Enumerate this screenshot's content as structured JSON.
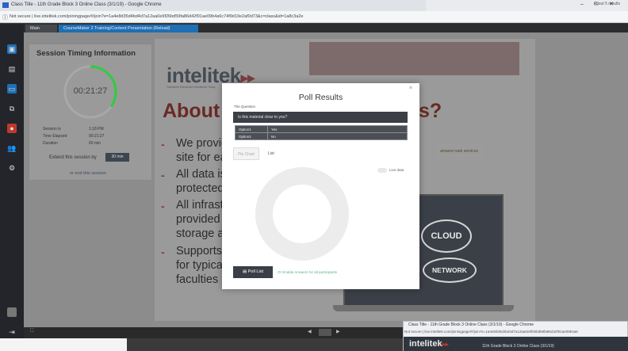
{
  "browser": {
    "title": "Class Title - 11th Grade Block 3 Online Class (3/1/19) - Google Chrome",
    "address": "Not secure | live.intelitek.com/joiningpage/#/join?e=1a4e8d35d4bd4d7a12aa0e9f26bd59fa86d42f01ae09b4a6c74f9d19e2af0d73&c=class&id=1a8c3a2e",
    "corner_text": "About 5 results",
    "window_controls": [
      "–",
      "□",
      "✕"
    ]
  },
  "tabs": [
    {
      "label": "Main"
    },
    {
      "label": "CourseMaker 2 Training/Content Presentation (Reload)"
    }
  ],
  "slide": {
    "logo": "intelitek",
    "logo_arrow": "▸▸",
    "tagline": "Transform Tomorrow's Workforce Today",
    "heading_left": "About",
    "heading_right": "s?",
    "bullets": [
      [
        "We provid",
        "site  for ea"
      ],
      [
        "All data is",
        "protected"
      ],
      [
        "All infrast",
        "provided b",
        "storage ar"
      ],
      [
        "Supports c",
        "for typical",
        "faculties"
      ]
    ],
    "partner_logo": "amazon web services",
    "cloud_text": "CLOUD",
    "network_text": "NETWORK"
  },
  "session": {
    "title": "Session Timing Information",
    "timer": "00:21:27",
    "rows": [
      {
        "label": "Session is",
        "value": "1:18 PM"
      },
      {
        "label": "Time Elapsed",
        "value": "00:21:27"
      },
      {
        "label": "Duration",
        "value": "60 min"
      }
    ],
    "extend_label": "Extend this session by",
    "extend_button": "30 min",
    "end_link": "or end this session"
  },
  "poll": {
    "title": "Poll Results",
    "close": "×",
    "question_label": "The Question",
    "question": "Is this material clear to you?",
    "options": [
      {
        "option": "Option1",
        "answer": "Yes"
      },
      {
        "option": "Option2",
        "answer": "No"
      }
    ],
    "chart_tab": "Pie Chart",
    "list_tab": "List",
    "toggle_label": "Live data",
    "poll_live_button": "Poll List",
    "enable_link": "Or Enable Answers for all participants"
  },
  "second_window": {
    "title": "Class Title - 11th Grade Block 3 Online Class (3/1/19) - Google Chrome",
    "address": "Not secure | live.intelitek.com/joiningpage/#/join?e=1a4e8d35d4bd4d7a12aa0e9f26bd59fa86d42f01ae09b4a6",
    "logo": "intelitek",
    "logo_arrow": "▸▸",
    "class_name": "11th Grade Block 3 Online Class (3/1/19)"
  },
  "colors": {
    "accent": "#1f6fb5",
    "timer": "#2ecc40",
    "brand_red": "#c0392b"
  }
}
